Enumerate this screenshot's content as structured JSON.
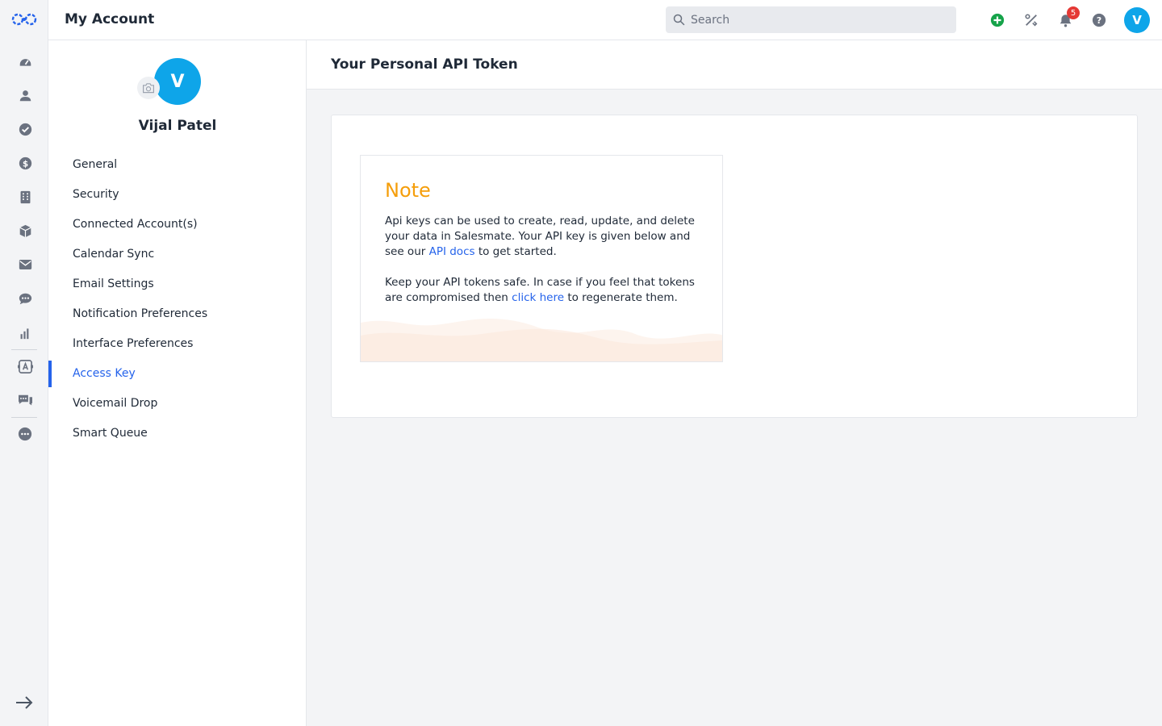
{
  "header": {
    "title": "My Account",
    "search_placeholder": "Search",
    "notification_count": "5",
    "avatar_initial": "V"
  },
  "rail": {
    "icons": [
      "logo-icon",
      "dashboard-icon",
      "contacts-icon",
      "tasks-icon",
      "deals-icon",
      "companies-icon",
      "products-icon",
      "email-icon",
      "chat-icon",
      "reports-icon",
      "automation-icon",
      "messages-icon",
      "more-icon",
      "expand-icon"
    ]
  },
  "profile": {
    "initial": "V",
    "name": "Vijal Patel"
  },
  "menu": {
    "items": [
      {
        "label": "General"
      },
      {
        "label": "Security"
      },
      {
        "label": "Connected Account(s)"
      },
      {
        "label": "Calendar Sync"
      },
      {
        "label": "Email Settings"
      },
      {
        "label": "Notification Preferences"
      },
      {
        "label": "Interface Preferences"
      },
      {
        "label": "Access Key"
      },
      {
        "label": "Voicemail Drop"
      },
      {
        "label": "Smart Queue"
      }
    ],
    "active": "Access Key"
  },
  "main": {
    "title": "Your Personal API Token",
    "note": {
      "title": "Note",
      "p1_before": "Api keys can be used to create, read, update, and delete your data in Salesmate. Your API key is given below and see our ",
      "p1_link": "API docs",
      "p1_after": " to get started.",
      "p2_before": "Keep your API tokens safe. In case if you feel that tokens are compromised then ",
      "p2_link": "click here",
      "p2_after": " to regenerate them."
    }
  },
  "colors": {
    "accent": "#2563eb",
    "avatar": "#0ea5e9",
    "note_title": "#f59e0b",
    "badge": "#e53935",
    "add_button": "#16a34a"
  }
}
